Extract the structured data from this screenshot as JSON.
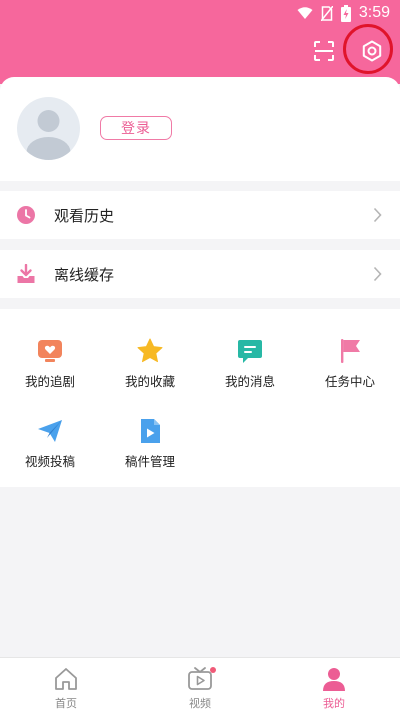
{
  "status_bar": {
    "time": "3:59",
    "icons": [
      "wifi-icon",
      "no-sim-icon",
      "battery-charging-icon"
    ]
  },
  "header": {
    "icons": [
      "scan-icon",
      "settings-icon"
    ],
    "accent_color": "#f6679c"
  },
  "profile": {
    "login_label": "登录"
  },
  "menu_rows": [
    {
      "label": "观看历史",
      "icon": "clock-icon"
    },
    {
      "label": "离线缓存",
      "icon": "download-icon"
    }
  ],
  "grid_items": [
    {
      "label": "我的追剧",
      "icon": "tv-heart-icon"
    },
    {
      "label": "我的收藏",
      "icon": "star-icon"
    },
    {
      "label": "我的消息",
      "icon": "message-icon"
    },
    {
      "label": "任务中心",
      "icon": "flag-icon"
    },
    {
      "label": "视频投稿",
      "icon": "paper-plane-icon"
    },
    {
      "label": "稿件管理",
      "icon": "document-play-icon"
    }
  ],
  "bottom_nav": [
    {
      "label": "首页",
      "icon": "home-icon",
      "active": false
    },
    {
      "label": "视频",
      "icon": "video-icon",
      "active": false
    },
    {
      "label": "我的",
      "icon": "user-icon",
      "active": true
    }
  ],
  "colors": {
    "highlight": "#e0142b",
    "active_tab": "#ec5d94"
  }
}
